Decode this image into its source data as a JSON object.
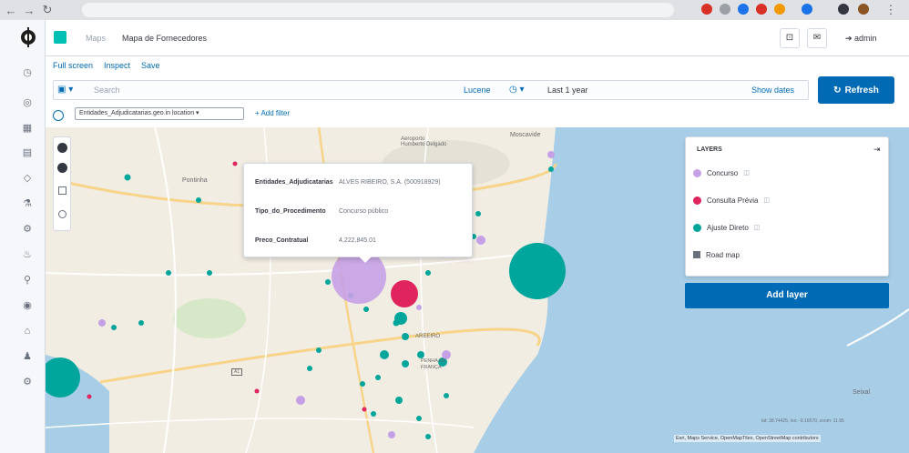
{
  "header": {
    "breadcrumb_app": "Maps",
    "breadcrumb_page": "Mapa de Fornecedores",
    "user": "admin"
  },
  "topnav": {
    "full_screen": "Full screen",
    "inspect": "Inspect",
    "save": "Save"
  },
  "query": {
    "placeholder": "Search",
    "language": "Lucene",
    "time_range": "Last 1 year",
    "show_dates": "Show dates",
    "refresh": "Refresh"
  },
  "filters": {
    "pill": "Entidades_Adjudicatarias.geo.in location",
    "add_filter": "+ Add filter"
  },
  "tooltip": {
    "rows": [
      {
        "key": "Entidades_Adjudicatarias",
        "value": "ALVES RIBEIRO, S.A. (500918929)"
      },
      {
        "key": "Tipo_do_Procedimento",
        "value": "Concurso público"
      },
      {
        "key": "Preco_Contratual",
        "value": "4,222,845.01"
      }
    ]
  },
  "layers": {
    "title": "LAYERS",
    "items": [
      {
        "name": "Concurso",
        "color": "#c6a0e6"
      },
      {
        "name": "Consulta Prévia",
        "color": "#e0245e"
      },
      {
        "name": "Ajuste Direto",
        "color": "#00a69b"
      },
      {
        "name": "Road map",
        "color": "#69707d"
      }
    ],
    "add_layer": "Add layer"
  },
  "map": {
    "labels": {
      "pontinha": "Pontinha",
      "moscavide": "Moscavide",
      "aeroporto": "Aeroporto\nHumberto Delgado",
      "areeiro": "AREEIRO",
      "penha_franca": "PENHA DE FRANÇA",
      "seixal": "Seixal",
      "a1": "A1"
    },
    "coords": "lat: 38.74425, lon: -9.16570, zoom: 11.95",
    "attribution": "Esri, Maps Service, OpenMapTiles, OpenStreetMap contributors"
  },
  "colors": {
    "accent": "#006bb4",
    "concurso": "#c6a0e6",
    "consulta": "#e0245e",
    "ajuste": "#00a69b",
    "water": "#a8cde6",
    "land": "#f2ede3"
  }
}
